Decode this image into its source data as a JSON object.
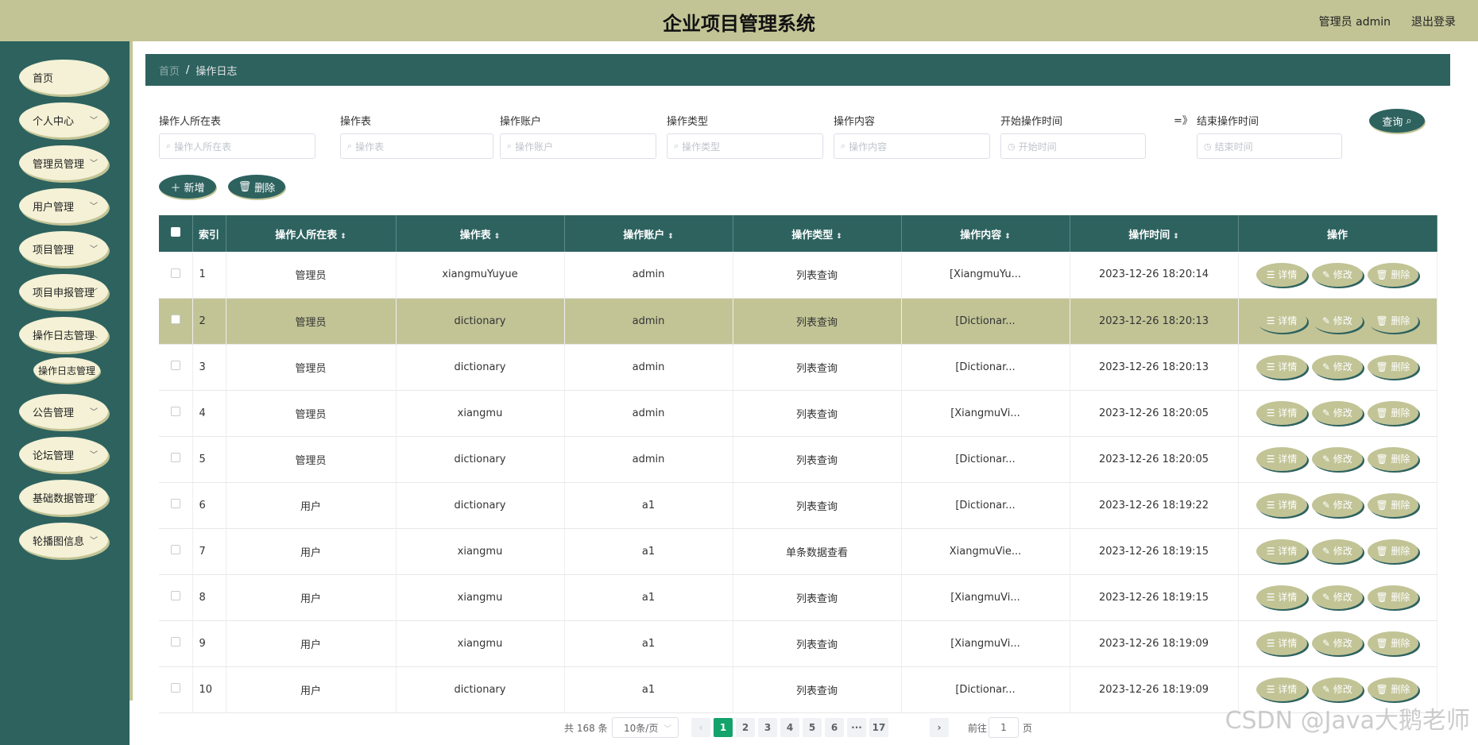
{
  "header": {
    "title": "企业项目管理系统",
    "user": "管理员 admin",
    "logout": "退出登录"
  },
  "sidebar": {
    "items": [
      "首页",
      "个人中心",
      "管理员管理",
      "用户管理",
      "项目管理",
      "项目申报管理",
      "操作日志管理",
      "公告管理",
      "论坛管理",
      "基础数据管理",
      "轮播图信息"
    ],
    "sub_item": "操作日志管理"
  },
  "breadcrumb": {
    "home": "首页",
    "separator": "/",
    "current": "操作日志"
  },
  "filters": {
    "labels": [
      "操作人所在表",
      "操作表",
      "操作账户",
      "操作类型",
      "操作内容",
      "开始操作时间",
      "结束操作时间"
    ],
    "placeholders": [
      "操作人所在表",
      "操作表",
      "操作账户",
      "操作类型",
      "操作内容",
      "开始时间",
      "结束时间"
    ],
    "range_mark": "=》",
    "search_label": "查询"
  },
  "toolbar": {
    "add_label": "新增",
    "delete_label": "删除"
  },
  "table": {
    "columns": [
      "索引",
      "操作人所在表",
      "操作表",
      "操作账户",
      "操作类型",
      "操作内容",
      "操作时间",
      "操作"
    ],
    "rows": [
      [
        "1",
        "管理员",
        "xiangmuYuyue",
        "admin",
        "列表查询",
        "[XiangmuYu...",
        "2023-12-26 18:20:14"
      ],
      [
        "2",
        "管理员",
        "dictionary",
        "admin",
        "列表查询",
        "[Dictionar...",
        "2023-12-26 18:20:13"
      ],
      [
        "3",
        "管理员",
        "dictionary",
        "admin",
        "列表查询",
        "[Dictionar...",
        "2023-12-26 18:20:13"
      ],
      [
        "4",
        "管理员",
        "xiangmu",
        "admin",
        "列表查询",
        "[XiangmuVi...",
        "2023-12-26 18:20:05"
      ],
      [
        "5",
        "管理员",
        "dictionary",
        "admin",
        "列表查询",
        "[Dictionar...",
        "2023-12-26 18:20:05"
      ],
      [
        "6",
        "用户",
        "dictionary",
        "a1",
        "列表查询",
        "[Dictionar...",
        "2023-12-26 18:19:22"
      ],
      [
        "7",
        "用户",
        "xiangmu",
        "a1",
        "单条数据查看",
        "XiangmuVie...",
        "2023-12-26 18:19:15"
      ],
      [
        "8",
        "用户",
        "xiangmu",
        "a1",
        "列表查询",
        "[XiangmuVi...",
        "2023-12-26 18:19:15"
      ],
      [
        "9",
        "用户",
        "xiangmu",
        "a1",
        "列表查询",
        "[XiangmuVi...",
        "2023-12-26 18:19:09"
      ],
      [
        "10",
        "用户",
        "dictionary",
        "a1",
        "列表查询",
        "[Dictionar...",
        "2023-12-26 18:19:09"
      ]
    ],
    "actions": [
      "详情",
      "修改",
      "删除"
    ],
    "highlighted_row": 2
  },
  "pagination": {
    "total": "共 168 条",
    "page_size": "10条/页",
    "pages": [
      "1",
      "2",
      "3",
      "4",
      "5",
      "6",
      "···",
      "17"
    ],
    "current": "1",
    "goto_prefix": "前往",
    "goto_value": "1",
    "goto_suffix": "页"
  },
  "watermark": "CSDN @Java大鹅老师",
  "colors": {
    "primary": "#2d625f",
    "accent": "#c2c496",
    "active_page": "#13a36b"
  }
}
